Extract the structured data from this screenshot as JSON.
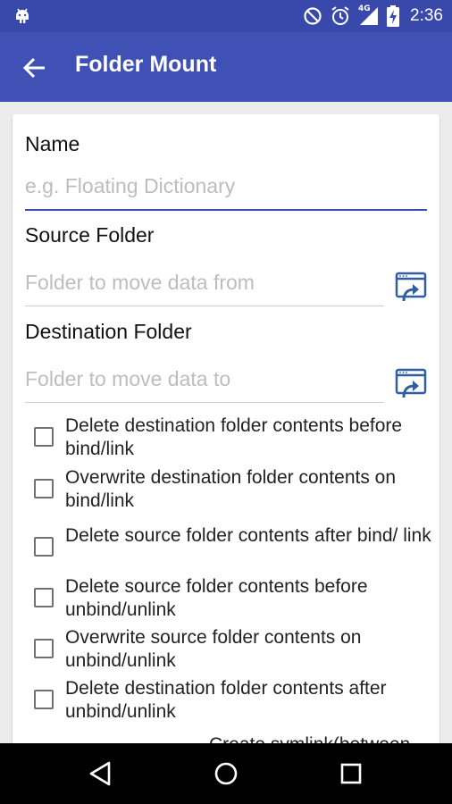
{
  "status_bar": {
    "time": "2:36",
    "network_label": "4G",
    "icons": [
      "android-icon",
      "do-not-disturb-icon",
      "alarm-icon",
      "signal-icon",
      "battery-charging-icon"
    ]
  },
  "app_bar": {
    "title": "Folder Mount",
    "back_icon": "arrow-back-icon"
  },
  "form": {
    "name": {
      "label": "Name",
      "placeholder": "e.g. Floating Dictionary",
      "value": ""
    },
    "source": {
      "label": "Source Folder",
      "placeholder": "Folder to move data from",
      "value": ""
    },
    "destination": {
      "label": "Destination Folder",
      "placeholder": "Folder to move data to",
      "value": ""
    },
    "checkboxes": [
      {
        "label": "Delete destination folder contents before bind/link",
        "checked": false
      },
      {
        "label": "Overwrite destination folder contents on bind/link",
        "checked": false
      },
      {
        "label": "Delete source folder contents after bind/ link",
        "checked": false
      },
      {
        "label": "Delete source folder contents before unbind/unlink",
        "checked": false
      },
      {
        "label": "Overwrite source folder contents on unbind/unlink",
        "checked": false
      },
      {
        "label": "Delete destination folder contents after unbind/unlink",
        "checked": false
      }
    ],
    "partial_text": "Create symlink(between"
  },
  "nav_bar": {
    "back_icon": "nav-back-icon",
    "home_icon": "nav-home-icon",
    "recents_icon": "nav-recents-icon"
  },
  "colors": {
    "status_bar": "#3949ab",
    "app_bar": "#3f51b5",
    "accent": "#3f51b5",
    "folder_icon": "#2f5f9f"
  }
}
